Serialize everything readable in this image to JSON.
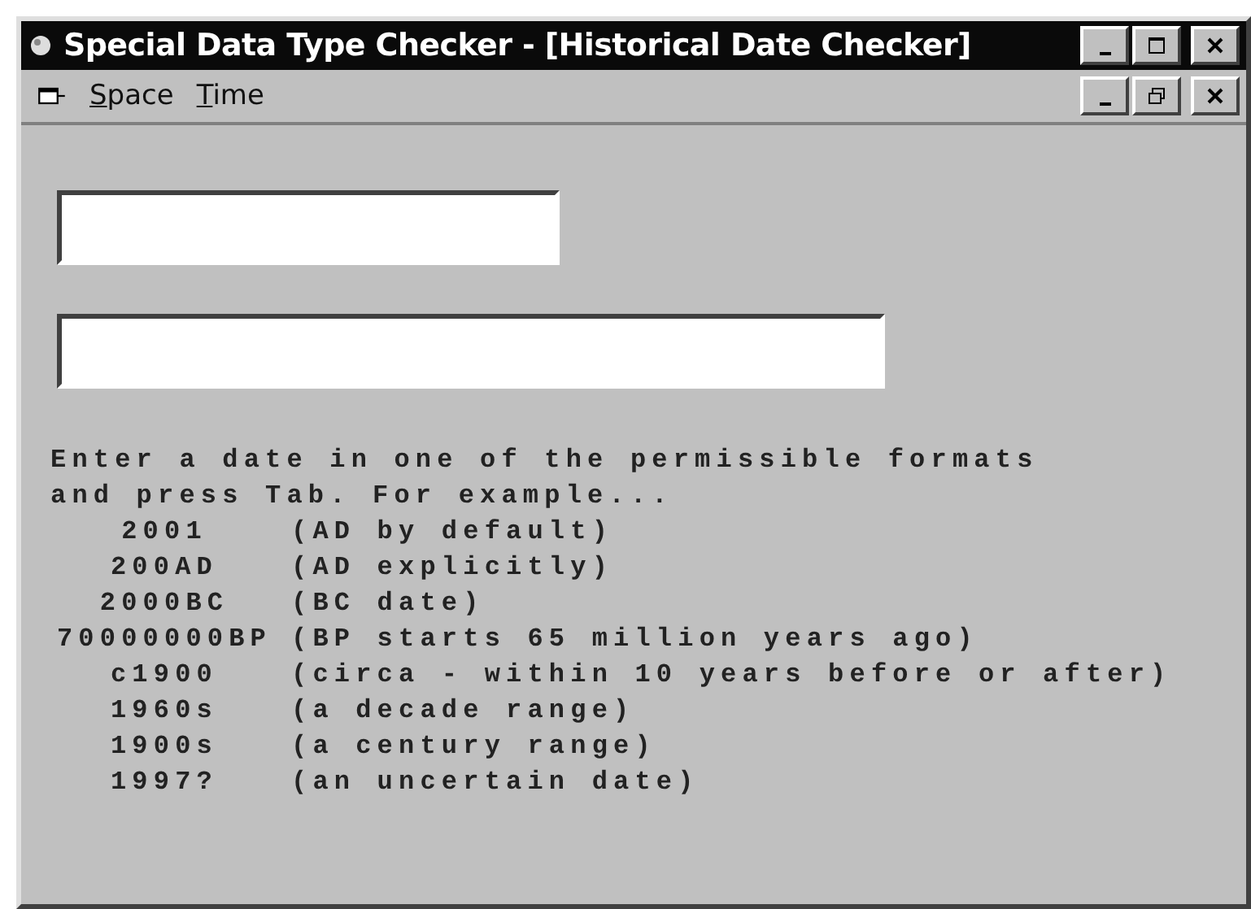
{
  "window": {
    "title": "Special Data Type Checker - [Historical Date Checker]"
  },
  "menu": [
    "Space",
    "Time"
  ],
  "fields": [
    {
      "kind": "short"
    },
    {
      "kind": "long"
    }
  ],
  "instructions": [
    "Enter a date in one of the permissible formats",
    "and press Tab. For example..."
  ],
  "examples": [
    {
      "date": "2001",
      "description": "(AD by default)"
    },
    {
      "date": "200AD",
      "description": "(AD explicitly)"
    },
    {
      "date": "2000BC",
      "description": "(BC date)"
    },
    {
      "date": "70000000BP",
      "description": "(BP starts 65 million years ago)"
    },
    {
      "date": "c1900",
      "description": "(circa - within 10 years before or after)"
    },
    {
      "date": "1960s",
      "description": "(a decade range)"
    },
    {
      "date": "1900s",
      "description": "(a century range)"
    },
    {
      "date": "1997?",
      "description": "(an uncertain date)"
    }
  ]
}
